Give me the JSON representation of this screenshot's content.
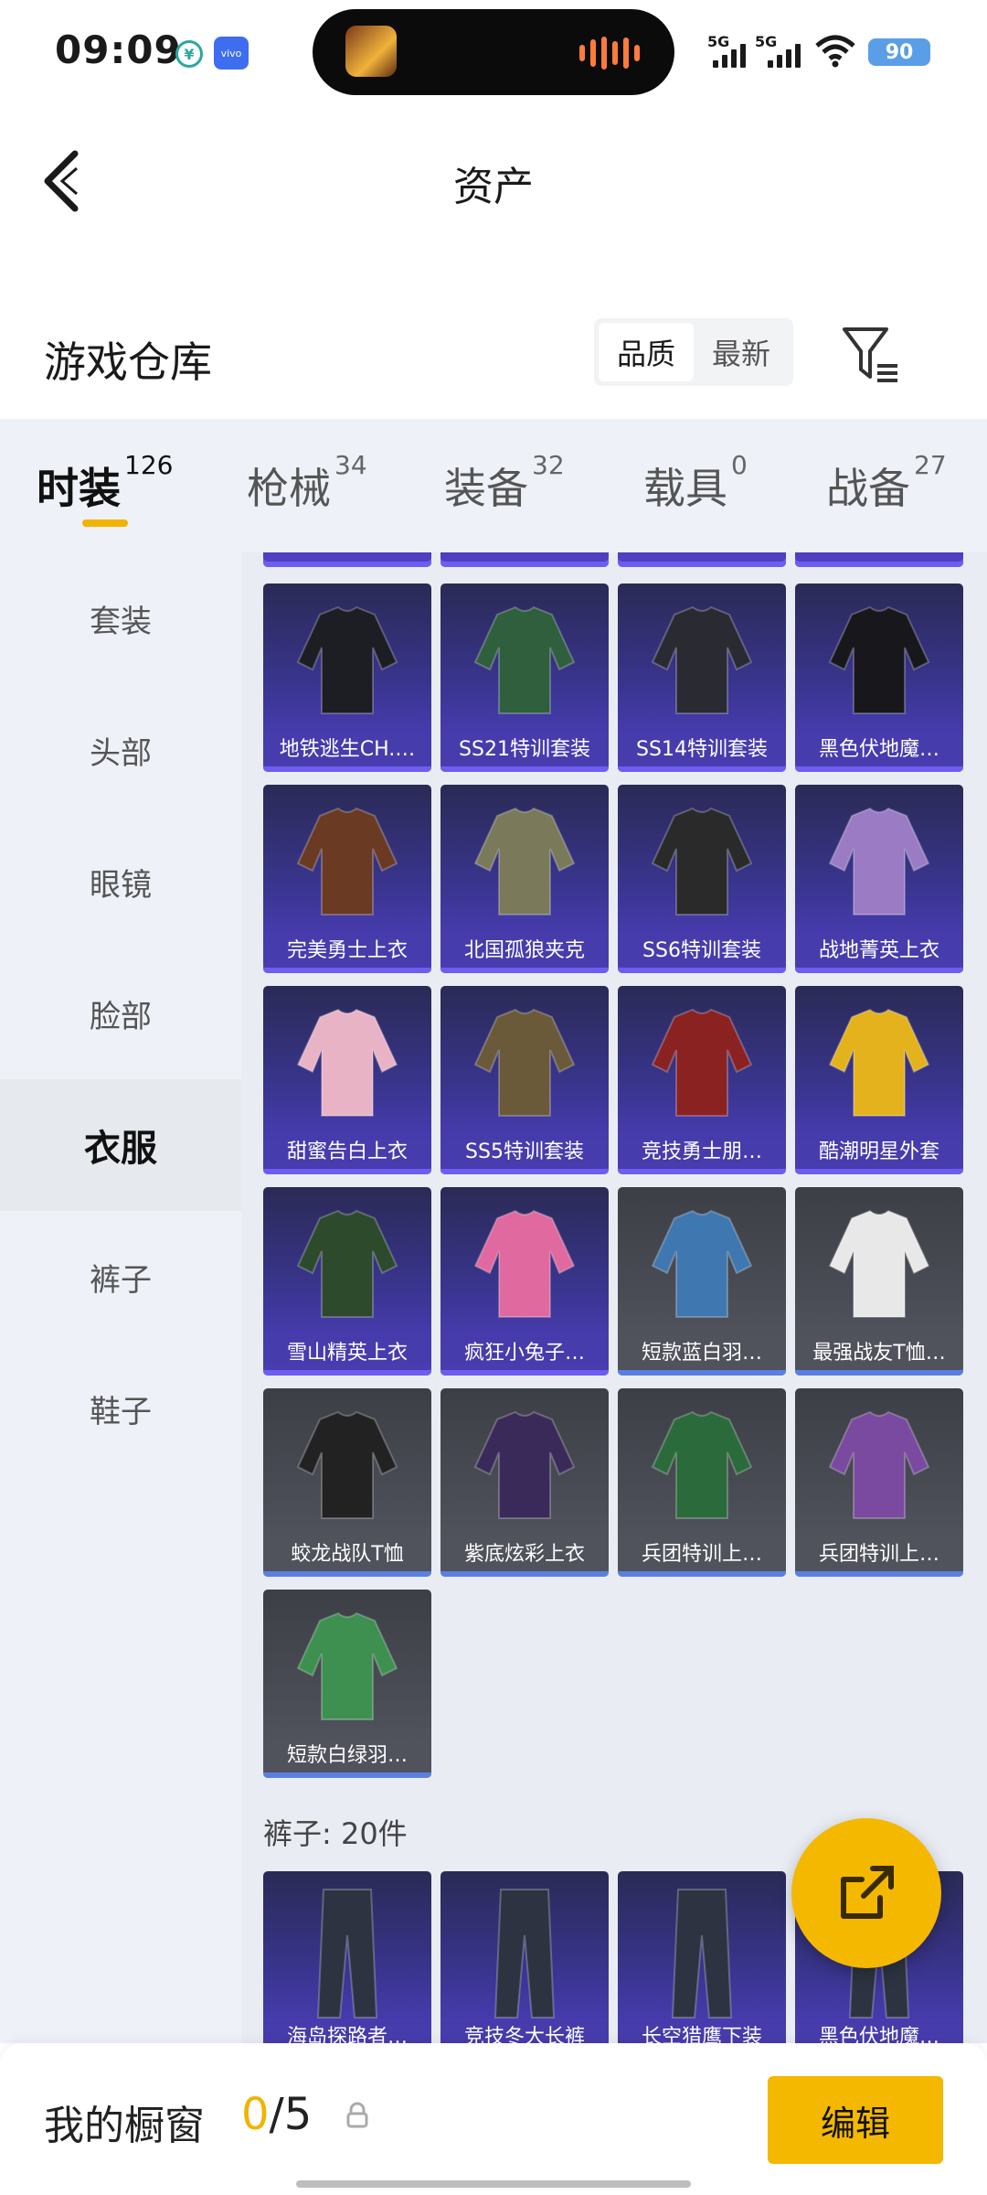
{
  "status_bar": {
    "time": "09:09",
    "signal1": "5G",
    "signal2": "5G",
    "battery": "90",
    "vivo": "vivo"
  },
  "header": {
    "title": "资产"
  },
  "section": {
    "title": "游戏仓库",
    "sort_quality": "品质",
    "sort_latest": "最新"
  },
  "category_tabs": [
    {
      "label": "时装",
      "count": "126"
    },
    {
      "label": "枪械",
      "count": "34"
    },
    {
      "label": "装备",
      "count": "32"
    },
    {
      "label": "载具",
      "count": "0"
    },
    {
      "label": "战备",
      "count": "27"
    }
  ],
  "sidebar": {
    "items": [
      "套装",
      "头部",
      "眼镜",
      "脸部",
      "衣服",
      "裤子",
      "鞋子"
    ],
    "active": "衣服"
  },
  "grid": {
    "items": [
      {
        "label": "地铁逃生CH.…",
        "rarity": "purple"
      },
      {
        "label": "SS21特训套装",
        "rarity": "purple"
      },
      {
        "label": "SS14特训套装",
        "rarity": "purple"
      },
      {
        "label": "黑色伏地魔…",
        "rarity": "purple"
      },
      {
        "label": "完美勇士上衣",
        "rarity": "purple"
      },
      {
        "label": "北国孤狼夹克",
        "rarity": "purple"
      },
      {
        "label": "SS6特训套装",
        "rarity": "purple"
      },
      {
        "label": "战地菁英上衣",
        "rarity": "purple"
      },
      {
        "label": "甜蜜告白上衣",
        "rarity": "purple"
      },
      {
        "label": "SS5特训套装",
        "rarity": "purple"
      },
      {
        "label": "竞技勇士朋…",
        "rarity": "purple"
      },
      {
        "label": "酷潮明星外套",
        "rarity": "purple"
      },
      {
        "label": "雪山精英上衣",
        "rarity": "purple"
      },
      {
        "label": "疯狂小兔子…",
        "rarity": "purple"
      },
      {
        "label": "短款蓝白羽…",
        "rarity": "grey"
      },
      {
        "label": "最强战友T恤…",
        "rarity": "grey"
      },
      {
        "label": "蛟龙战队T恤",
        "rarity": "grey"
      },
      {
        "label": "紫底炫彩上衣",
        "rarity": "grey"
      },
      {
        "label": "兵团特训上…",
        "rarity": "grey"
      },
      {
        "label": "兵团特训上…",
        "rarity": "grey"
      },
      {
        "label": "短款白绿羽…",
        "rarity": "grey"
      }
    ],
    "pants_heading": "裤子: 20件",
    "pants_items": [
      {
        "label": "海岛探路者…"
      },
      {
        "label": "竞技冬大长裤"
      },
      {
        "label": "长空猎鹰下装"
      },
      {
        "label": "黑色伏地魔…"
      }
    ]
  },
  "bottom_bar": {
    "label": "我的橱窗",
    "current": "0",
    "total": "/5",
    "edit": "编辑"
  },
  "colors": {
    "accent": "#f5b800",
    "purple_card": "#3a3590",
    "grey_card": "#4a4d55"
  }
}
